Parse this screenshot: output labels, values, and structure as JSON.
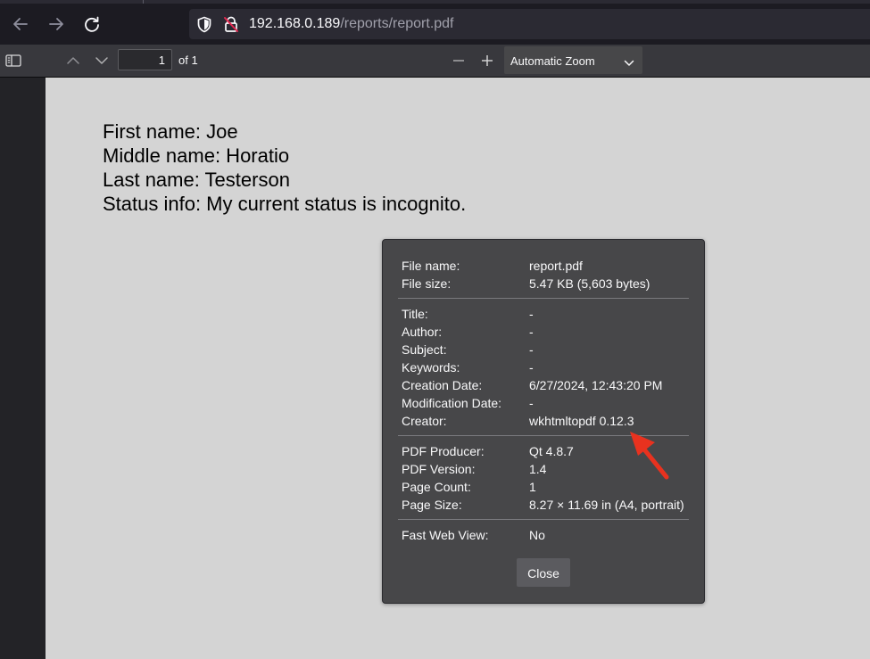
{
  "browser": {
    "url_host": "192.168.0.189",
    "url_path": "/reports/report.pdf"
  },
  "toolbar": {
    "page_number": "1",
    "page_count_label": "of 1",
    "zoom_label": "Automatic Zoom"
  },
  "document": {
    "lines": [
      "First name: Joe",
      "Middle name: Horatio",
      "Last name: Testerson",
      "Status info: My current status is incognito."
    ]
  },
  "properties": {
    "file_name_label": "File name:",
    "file_name": "report.pdf",
    "file_size_label": "File size:",
    "file_size": "5.47 KB (5,603 bytes)",
    "title_label": "Title:",
    "title": "-",
    "author_label": "Author:",
    "author": "-",
    "subject_label": "Subject:",
    "subject": "-",
    "keywords_label": "Keywords:",
    "keywords": "-",
    "creation_date_label": "Creation Date:",
    "creation_date": "6/27/2024, 12:43:20 PM",
    "modification_date_label": "Modification Date:",
    "modification_date": "-",
    "creator_label": "Creator:",
    "creator": "wkhtmltopdf 0.12.3",
    "producer_label": "PDF Producer:",
    "producer": "Qt 4.8.7",
    "version_label": "PDF Version:",
    "version": "1.4",
    "page_count_label": "Page Count:",
    "page_count": "1",
    "page_size_label": "Page Size:",
    "page_size": "8.27 × 11.69 in (A4, portrait)",
    "fast_web_view_label": "Fast Web View:",
    "fast_web_view": "No",
    "close_label": "Close"
  },
  "icons": {
    "back": "arrow-left-icon",
    "forward": "arrow-right-icon",
    "reload": "reload-icon",
    "tracking_protection": "shield-icon",
    "insecure_connection": "lock-strikethrough-icon",
    "sidebar_toggle": "sidebar-icon",
    "previous_page": "chevron-up-icon",
    "next_page": "chevron-down-icon",
    "zoom_out": "minus-icon",
    "zoom_in": "plus-icon",
    "annotation_arrow": "red-arrow-icon"
  },
  "colors": {
    "browser_bg": "#1c1b22",
    "toolbar_bg": "#38383d",
    "dialog_bg": "#474749",
    "viewer_bg": "#d4d4d4",
    "annotation_red": "#e8321f",
    "insecure_red": "#e22850"
  }
}
